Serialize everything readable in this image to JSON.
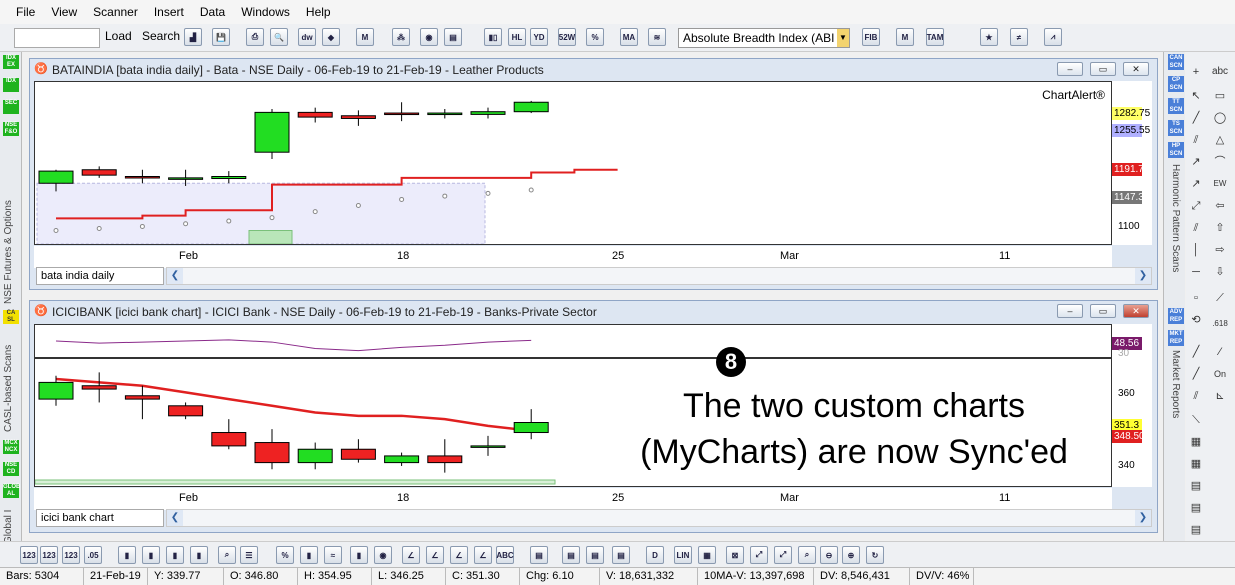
{
  "menu": [
    "File",
    "View",
    "Scanner",
    "Insert",
    "Data",
    "Windows",
    "Help"
  ],
  "toolbar": {
    "load_label": "Load",
    "search_label": "Search",
    "indicator_select": "Absolute Breadth Index (ABI"
  },
  "left_strip": {
    "badges1": [
      "IDX EX",
      "IDX",
      "SEC",
      "NSE F&O"
    ],
    "label1": "NSE Futures & Options",
    "badges2": [
      "CA SL"
    ],
    "label2": "CASL-based Scans",
    "badges3": [
      "MCX NCX",
      "NSE CD",
      "GLOB AL"
    ],
    "label3": "Global I"
  },
  "right_panel": {
    "badges1": [
      "CAN SCN",
      "CP SCN",
      "TT SCN",
      "TS SCN",
      "HP SCN"
    ],
    "label1": "Harmonic Pattern Scans",
    "badges2": [
      "ADV REP",
      "MKT REP"
    ],
    "label2": "Market Reports"
  },
  "chart1": {
    "title": "BATAINDIA [bata india daily] - Bata - NSE Daily - 06-Feb-19 to 21-Feb-19 - Leather Products",
    "watermark": "ChartAlert®",
    "tags": [
      {
        "label": "1282.75",
        "color": "#ffff66"
      },
      {
        "label": "1255.55",
        "color": "#b0b0ff"
      },
      {
        "label": "1191.70",
        "color": "#e02020"
      },
      {
        "label": "1147.35",
        "color": "#777777"
      }
    ],
    "ticks": [
      "1100"
    ],
    "dates": [
      "Feb",
      "18",
      "25",
      "Mar",
      "11"
    ],
    "sheet": "bata india daily"
  },
  "chart2": {
    "title": "ICICIBANK [icici bank chart] - ICICI Bank - NSE Daily - 06-Feb-19 to 21-Feb-19 - Banks-Private Sector",
    "tags": [
      {
        "label": "48.56",
        "color": "#7a1a6a"
      },
      {
        "label": "351.3",
        "color": "#ffff33"
      },
      {
        "label": "348.50",
        "color": "#e02020"
      }
    ],
    "indicator_tick": "30",
    "ticks": [
      "360",
      "340"
    ],
    "dates": [
      "Feb",
      "18",
      "25",
      "Mar",
      "11"
    ],
    "sheet": "icici bank chart"
  },
  "annotation": {
    "number": "8",
    "line1": "The two custom charts",
    "line2": "(MyCharts) are now Sync'ed"
  },
  "status": {
    "bars": "Bars: 5304",
    "date": "21-Feb-19",
    "y": "Y: 339.77",
    "o": "O: 346.80",
    "h": "H: 354.95",
    "l": "L: 346.25",
    "c": "C: 351.30",
    "chg": "Chg: 6.10",
    "v": "V: 18,631,332",
    "mav": "10MA-V: 13,397,698",
    "dv": "DV: 8,546,431",
    "dvv": "DV/V: 46%"
  },
  "chart_data": [
    {
      "type": "candlestick",
      "symbol": "BATAINDIA",
      "candles": [
        {
          "o": 1150,
          "c": 1168,
          "h": 1170,
          "l": 1138
        },
        {
          "o": 1170,
          "c": 1162,
          "h": 1175,
          "l": 1158
        },
        {
          "o": 1160,
          "c": 1159,
          "h": 1170,
          "l": 1150
        },
        {
          "o": 1157,
          "c": 1158,
          "h": 1170,
          "l": 1146
        },
        {
          "o": 1157,
          "c": 1160,
          "h": 1168,
          "l": 1150
        },
        {
          "o": 1196,
          "c": 1255,
          "h": 1260,
          "l": 1186
        },
        {
          "o": 1255,
          "c": 1248,
          "h": 1262,
          "l": 1240
        },
        {
          "o": 1250,
          "c": 1246,
          "h": 1258,
          "l": 1235
        },
        {
          "o": 1254,
          "c": 1253,
          "h": 1270,
          "l": 1242
        },
        {
          "o": 1252,
          "c": 1254,
          "h": 1260,
          "l": 1246
        },
        {
          "o": 1252,
          "c": 1256,
          "h": 1262,
          "l": 1246
        },
        {
          "o": 1256,
          "c": 1270,
          "h": 1272,
          "l": 1254
        }
      ],
      "ma_line": [
        1098,
        1098,
        1102,
        1110,
        1110,
        1148,
        1148,
        1148,
        1158,
        1158,
        1158,
        1166,
        1170
      ],
      "dots": [
        1080,
        1083,
        1086,
        1090,
        1094,
        1099,
        1108,
        1117,
        1126,
        1131,
        1135,
        1140
      ]
    },
    {
      "type": "candlestick",
      "symbol": "ICICIBANK",
      "candles": [
        {
          "o": 358,
          "c": 363,
          "h": 365,
          "l": 356
        },
        {
          "o": 362,
          "c": 361,
          "h": 366,
          "l": 357
        },
        {
          "o": 359,
          "c": 358,
          "h": 362,
          "l": 352
        },
        {
          "o": 356,
          "c": 353,
          "h": 357,
          "l": 352
        },
        {
          "o": 348,
          "c": 344,
          "h": 352,
          "l": 343
        },
        {
          "o": 345,
          "c": 339,
          "h": 349,
          "l": 337
        },
        {
          "o": 339,
          "c": 343,
          "h": 345,
          "l": 337
        },
        {
          "o": 343,
          "c": 340,
          "h": 346,
          "l": 339
        },
        {
          "o": 339,
          "c": 341,
          "h": 342,
          "l": 338
        },
        {
          "o": 341,
          "c": 339,
          "h": 346,
          "l": 336
        },
        {
          "o": 344,
          "c": 344,
          "h": 347,
          "l": 341
        },
        {
          "o": 348,
          "c": 351,
          "h": 355,
          "l": 346
        }
      ],
      "ma_line": [
        364,
        363,
        362,
        360,
        358,
        356,
        354,
        353,
        353,
        352,
        350,
        348.5
      ],
      "indicator_line": [
        48.5,
        48.3,
        48.4,
        48.5,
        48.6,
        48.4,
        47.8,
        47.6,
        47.9,
        48.1,
        48.4,
        48.56
      ]
    }
  ]
}
